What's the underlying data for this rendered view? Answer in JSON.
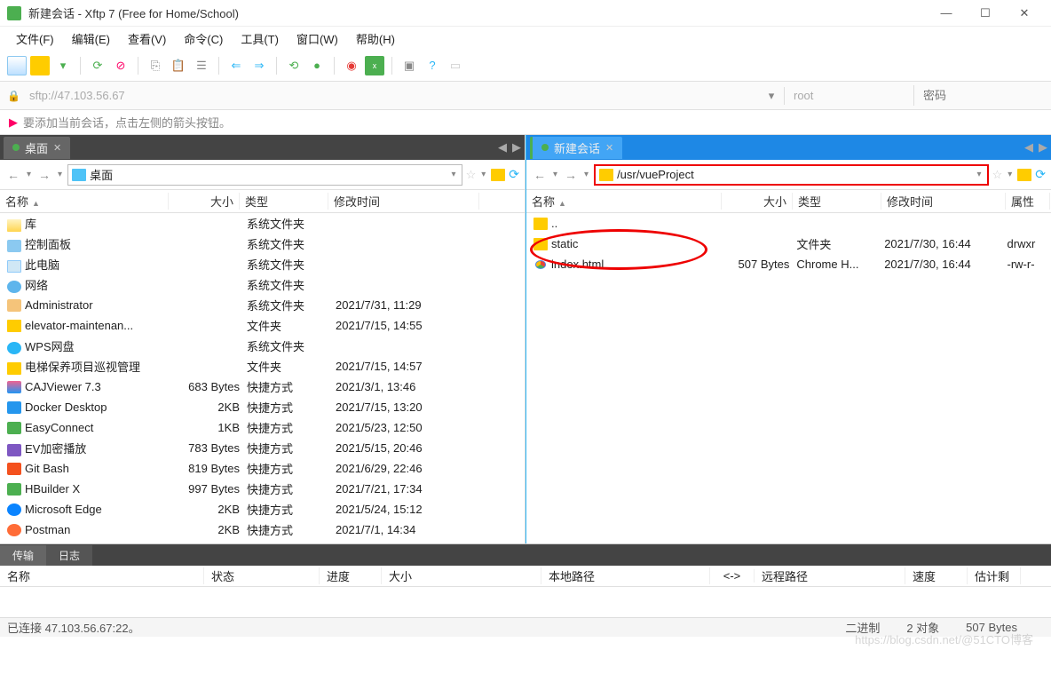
{
  "window": {
    "title": "新建会话 - Xftp 7 (Free for Home/School)"
  },
  "menu": [
    "文件(F)",
    "编辑(E)",
    "查看(V)",
    "命令(C)",
    "工具(T)",
    "窗口(W)",
    "帮助(H)"
  ],
  "address": {
    "url": "sftp://47.103.56.67",
    "user": "root",
    "password_placeholder": "密码"
  },
  "hint": "要添加当前会话，点击左侧的箭头按钮。",
  "left": {
    "tab": "桌面",
    "path": "桌面",
    "columns": [
      "名称",
      "大小",
      "类型",
      "修改时间"
    ],
    "rows": [
      {
        "icon": "lib",
        "name": "库",
        "size": "",
        "type": "系统文件夹",
        "mtime": ""
      },
      {
        "icon": "cpanel",
        "name": "控制面板",
        "size": "",
        "type": "系统文件夹",
        "mtime": ""
      },
      {
        "icon": "pc",
        "name": "此电脑",
        "size": "",
        "type": "系统文件夹",
        "mtime": ""
      },
      {
        "icon": "net",
        "name": "网络",
        "size": "",
        "type": "系统文件夹",
        "mtime": ""
      },
      {
        "icon": "user",
        "name": "Administrator",
        "size": "",
        "type": "系统文件夹",
        "mtime": "2021/7/31, 11:29"
      },
      {
        "icon": "folder",
        "name": "elevator-maintenan...",
        "size": "",
        "type": "文件夹",
        "mtime": "2021/7/15, 14:55"
      },
      {
        "icon": "wps",
        "name": "WPS网盘",
        "size": "",
        "type": "系统文件夹",
        "mtime": ""
      },
      {
        "icon": "folder",
        "name": "电梯保养项目巡视管理",
        "size": "",
        "type": "文件夹",
        "mtime": "2021/7/15, 14:57"
      },
      {
        "icon": "caj",
        "name": "CAJViewer 7.3",
        "size": "683 Bytes",
        "type": "快捷方式",
        "mtime": "2021/3/1, 13:46"
      },
      {
        "icon": "docker",
        "name": "Docker Desktop",
        "size": "2KB",
        "type": "快捷方式",
        "mtime": "2021/7/15, 13:20"
      },
      {
        "icon": "easy",
        "name": "EasyConnect",
        "size": "1KB",
        "type": "快捷方式",
        "mtime": "2021/5/23, 12:50"
      },
      {
        "icon": "ev",
        "name": "EV加密播放",
        "size": "783 Bytes",
        "type": "快捷方式",
        "mtime": "2021/5/15, 20:46"
      },
      {
        "icon": "git",
        "name": "Git Bash",
        "size": "819 Bytes",
        "type": "快捷方式",
        "mtime": "2021/6/29, 22:46"
      },
      {
        "icon": "hb",
        "name": "HBuilder X",
        "size": "997 Bytes",
        "type": "快捷方式",
        "mtime": "2021/7/21, 17:34"
      },
      {
        "icon": "edge",
        "name": "Microsoft Edge",
        "size": "2KB",
        "type": "快捷方式",
        "mtime": "2021/5/24, 15:12"
      },
      {
        "icon": "pm",
        "name": "Postman",
        "size": "2KB",
        "type": "快捷方式",
        "mtime": "2021/7/1, 14:34"
      }
    ],
    "colwidths": {
      "name": 190,
      "size": 80,
      "type": 100,
      "mtime": 170
    }
  },
  "right": {
    "tab": "新建会话",
    "path": "/usr/vueProject",
    "columns": [
      "名称",
      "大小",
      "类型",
      "修改时间",
      "属性"
    ],
    "rows": [
      {
        "icon": "folder",
        "name": "..",
        "size": "",
        "type": "",
        "mtime": "",
        "attr": ""
      },
      {
        "icon": "folder",
        "name": "static",
        "size": "",
        "type": "文件夹",
        "mtime": "2021/7/30, 16:44",
        "attr": "drwxr"
      },
      {
        "icon": "chrome",
        "name": "index.html",
        "size": "507 Bytes",
        "type": "Chrome H...",
        "mtime": "2021/7/30, 16:44",
        "attr": "-rw-r-"
      }
    ],
    "colwidths": {
      "name": 220,
      "size": 80,
      "type": 100,
      "mtime": 140,
      "attr": 50
    }
  },
  "transfer": {
    "tabs": [
      "传输",
      "日志"
    ],
    "columns": [
      "名称",
      "状态",
      "进度",
      "大小",
      "本地路径",
      "<->",
      "远程路径",
      "速度",
      "估计剩"
    ]
  },
  "status": {
    "conn": "已连接 47.103.56.67:22。",
    "binary": "二进制",
    "objects": "2 对象",
    "bytes": "507 Bytes"
  },
  "watermark": "https://blog.csdn.net/@51CTO博客"
}
